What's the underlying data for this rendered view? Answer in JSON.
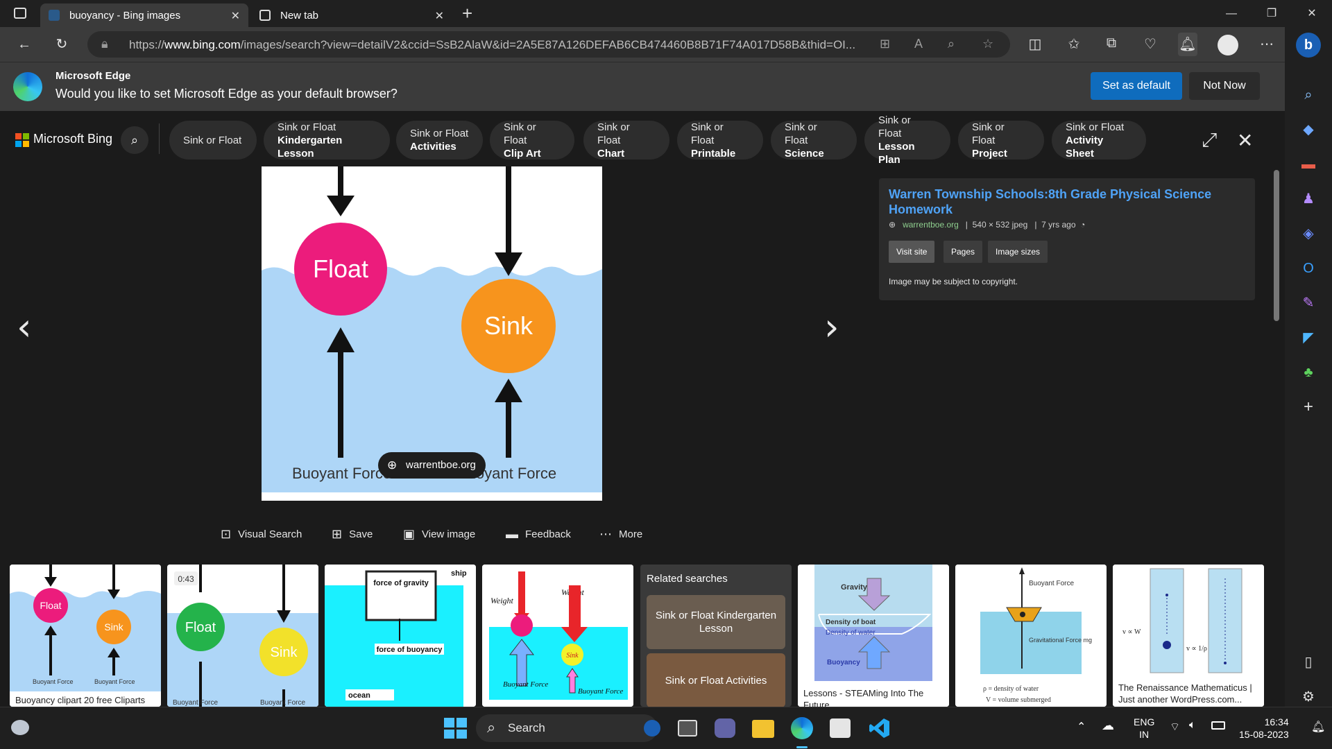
{
  "browser": {
    "tabs": [
      {
        "title": "buoyancy - Bing images",
        "active": true
      },
      {
        "title": "New tab",
        "active": false
      }
    ],
    "address": {
      "prefix": "https://",
      "domain": "www.bing.com",
      "path": "/images/search?view=detailV2&ccid=SsB2AlaW&id=2A5E87A126DEFAB6CB474460B8B71F74A017D58B&thid=OI..."
    }
  },
  "infobar": {
    "title": "Microsoft Edge",
    "message": "Would you like to set Microsoft Edge as your default browser?",
    "primary": "Set as default",
    "secondary": "Not Now"
  },
  "bing": {
    "brand": "Microsoft Bing",
    "chips": [
      {
        "l1": "Sink or Float",
        "l2": ""
      },
      {
        "l1": "Sink or Float",
        "l2": "Kindergarten Lesson"
      },
      {
        "l1": "Sink or Float",
        "l2": "Activities"
      },
      {
        "l1": "Sink or Float",
        "l2": "Clip Art"
      },
      {
        "l1": "Sink or Float",
        "l2": "Chart"
      },
      {
        "l1": "Sink or Float",
        "l2": "Printable"
      },
      {
        "l1": "Sink or Float",
        "l2": "Science"
      },
      {
        "l1": "Sink or Float",
        "l2": "Lesson Plan"
      },
      {
        "l1": "Sink or Float",
        "l2": "Project"
      },
      {
        "l1": "Sink or Float",
        "l2": "Activity Sheet"
      }
    ]
  },
  "main_image": {
    "float_label": "Float",
    "sink_label": "Sink",
    "buoyant_left": "Buoyant Force",
    "buoyant_right": "Buoyant Force",
    "source_pill": "warrentboe.org"
  },
  "info_panel": {
    "title": "Warren Township Schools:8th Grade Physical Science Homework",
    "site": "warrentboe.org",
    "dims": "540 × 532 jpeg",
    "age": "7 yrs ago",
    "buttons": [
      "Visit site",
      "Pages",
      "Image sizes"
    ],
    "copyright": "Image may be subject to copyright."
  },
  "actions": [
    "Visual Search",
    "Save",
    "View image",
    "Feedback",
    "More"
  ],
  "thumbs": {
    "t1_caption": "Buoyancy clipart 20 free Cliparts",
    "t1_float": "Float",
    "t1_sink": "Sink",
    "t1_bf": "Buoyant Force",
    "t2_duration": "0:43",
    "t2_float": "Float",
    "t2_sink": "Sink",
    "t2_bf": "Buoyant Force",
    "t3_ship": "ship",
    "t3_gravity": "force of gravity",
    "t3_buoyancy": "force of buoyancy",
    "t3_ocean": "ocean",
    "t4_weight": "Weight",
    "t4_sink": "Sink",
    "t4_bf": "Buoyant Force",
    "related_title": "Related searches",
    "related_1": "Sink or Float Kindergarten Lesson",
    "related_2": "Sink or Float Activities",
    "t6_gravity": "Gravity",
    "t6_boat": "Density of boat",
    "t6_water": "Density of water",
    "t6_buoy": "Buoyancy",
    "t6_caption": "Lessons - STEAMing Into The Future",
    "t7_bf": "Buoyant Force",
    "t7_grav": "Gravitational Force mg",
    "t7_rho": "ρ = density of water",
    "t7_v": "V = volume submerged",
    "t8_caption": "The Renaissance Mathematicus | Just another WordPress.com..."
  },
  "taskbar": {
    "search": "Search",
    "lang1": "ENG",
    "lang2": "IN",
    "time": "16:34",
    "date": "15-08-2023"
  }
}
